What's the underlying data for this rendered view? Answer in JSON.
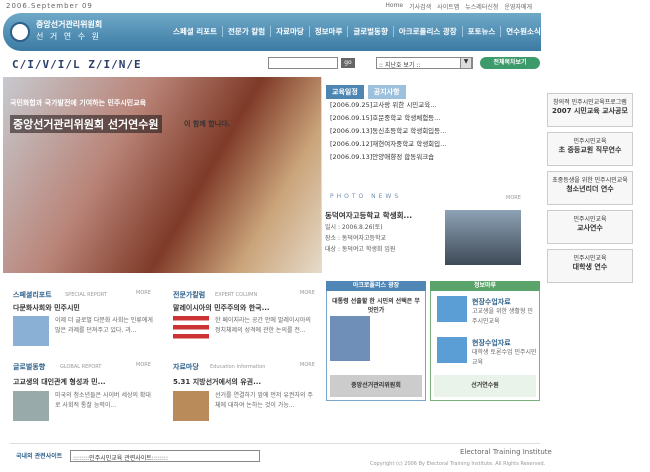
{
  "top": {
    "date": "2006.September 09",
    "links": [
      "Home",
      "기사검색",
      "사이트맵",
      "뉴스레터신청",
      "운영자메게"
    ]
  },
  "header": {
    "org_name": "중앙선거관리위원회",
    "org_sub": "선 거 연 수 원",
    "nav": [
      "스페셜 리포트",
      "전문가 칼럼",
      "자료마당",
      "정보마루",
      "글로벌동향",
      "아크로폴리스 광장",
      "포토뉴스",
      "연수원소식"
    ]
  },
  "subbar": {
    "brand": "C/I/V/I/L Z/I/N/E",
    "go": "go",
    "site_select": ":: 지난호 보기 ::",
    "all_button": "전체목차보기"
  },
  "hero": {
    "subtitle": "국민화합과 국가발전에 기여하는 민주시민교육",
    "title": "중앙선거관리위원회 선거연수원",
    "title_tail": "이 함께 합니다."
  },
  "notice": {
    "tabs": [
      "교육일정",
      "공지사항"
    ],
    "items": [
      "[2006.09.25]고사랑 위한 시민교육...",
      "[2006.09.15]호문중학교 학생체험등...",
      "[2006.09.13]동신초등학교 학생회입등...",
      "[2006.09.12]재현여자중학교 학생회입...",
      "[2006.09.13]안양애향정 합동워크숍"
    ]
  },
  "photo": {
    "header": "PHOTO NEWS",
    "more": "MORE",
    "title": "동덕여자고등학교 학생회...",
    "lines": [
      "일시 : 2006.8.26(토)",
      "장소 : 동덕여자고등학교",
      "대상 : 동덕여고 학생회 임원"
    ]
  },
  "banners": [
    {
      "title": "2007 시민교육 교사공모",
      "sub": "창의적 민주시민교육프로그램"
    },
    {
      "title": "초 중등교원 직무연수",
      "sub": "민주시민교육"
    },
    {
      "title": "청소년리더 연수",
      "sub": "초중등생을 위한 민주시민교육"
    },
    {
      "title": "교사연수",
      "sub": "민주시민교육"
    },
    {
      "title": "대학생 연수",
      "sub": "민주시민교육"
    }
  ],
  "sections": {
    "special": {
      "title": "스페셜리포트",
      "tag": "SPECIAL REPORT",
      "more": "MORE",
      "headline": "다문화사회와 민주시민",
      "desc": "이제 더 글로벌 다문화 사회는 인류에게 많은 과제를 던져주고 있다. 과..."
    },
    "global": {
      "title": "글로벌동향",
      "tag": "GLOBAL REPORT",
      "more": "MORE",
      "headline": "고교생의 대인관계 형성과 민...",
      "desc": "미국의 청소년들은 사이버 세상의 확대로 사회적 통찰 능력이..."
    },
    "column": {
      "title": "전문가칼럼",
      "tag": "EXPERT COLUMN",
      "more": "MORE",
      "headline": "말레이시아의 민주주의와 한국...",
      "desc": "한 페이지라는 공간 안에 말레이시아의 정치체제의 성격에 관한 논의를 전..."
    },
    "data": {
      "title": "자료마당",
      "tag": "Education Information",
      "more": "MORE",
      "headline": "5.31 지방선거에서의 유권...",
      "desc": "선거를 연결하기 앞에 먼저 유권자의 주체에 대하여 논하는 것이 가능..."
    }
  },
  "acro": {
    "title": "아크로폴리스 광장",
    "quote": "대통령 선출할 한 시민의 선택은 무엇인가",
    "caption": "중앙선거관리위원회"
  },
  "infomaru": {
    "title": "정보마루",
    "items": [
      {
        "title": "현장수업자료",
        "sub": "고교생을 위한 생활형 민주시민교육"
      },
      {
        "title": "현장수업자료",
        "sub": "대학생 토론수업 민주시민교육"
      }
    ],
    "caption": "선거연수원"
  },
  "footer": {
    "label": "국내외 관련사이트",
    "select": "::::::::민주시민교육 관련사이트::::::::",
    "brand": "Electoral Training Institute",
    "copy": "Copyright (c) 2006 By Electoral Training Institute. All Rights Reserved."
  }
}
